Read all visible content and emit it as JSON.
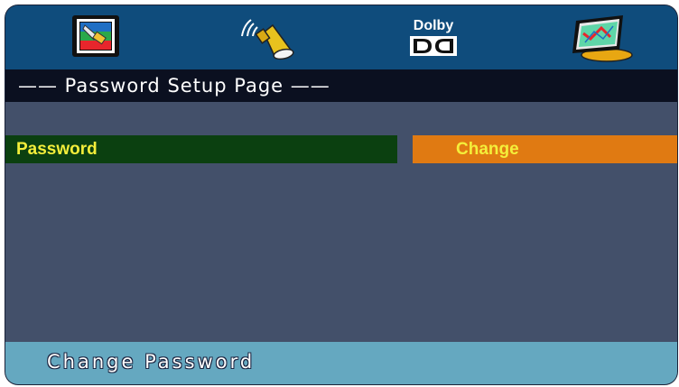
{
  "menu": {
    "tabs": [
      {
        "icon": "tv-display-icon"
      },
      {
        "icon": "speaker-audio-icon"
      },
      {
        "icon": "dolby-digital-icon",
        "label": "Dolby"
      },
      {
        "icon": "preference-chart-icon"
      }
    ]
  },
  "page": {
    "title": "—— Password Setup Page ——"
  },
  "settings": {
    "rows": [
      {
        "label": "Password",
        "value": "Change"
      }
    ]
  },
  "footer": {
    "hint": "Change Password"
  },
  "colors": {
    "topbar": "#0f4c7c",
    "title_bar": "#0b1020",
    "body": "#43506a",
    "row_label_bg": "#0b4010",
    "row_value_bg": "#e07a12",
    "text_yellow": "#f4ee3a",
    "footer": "#65a8c0"
  }
}
